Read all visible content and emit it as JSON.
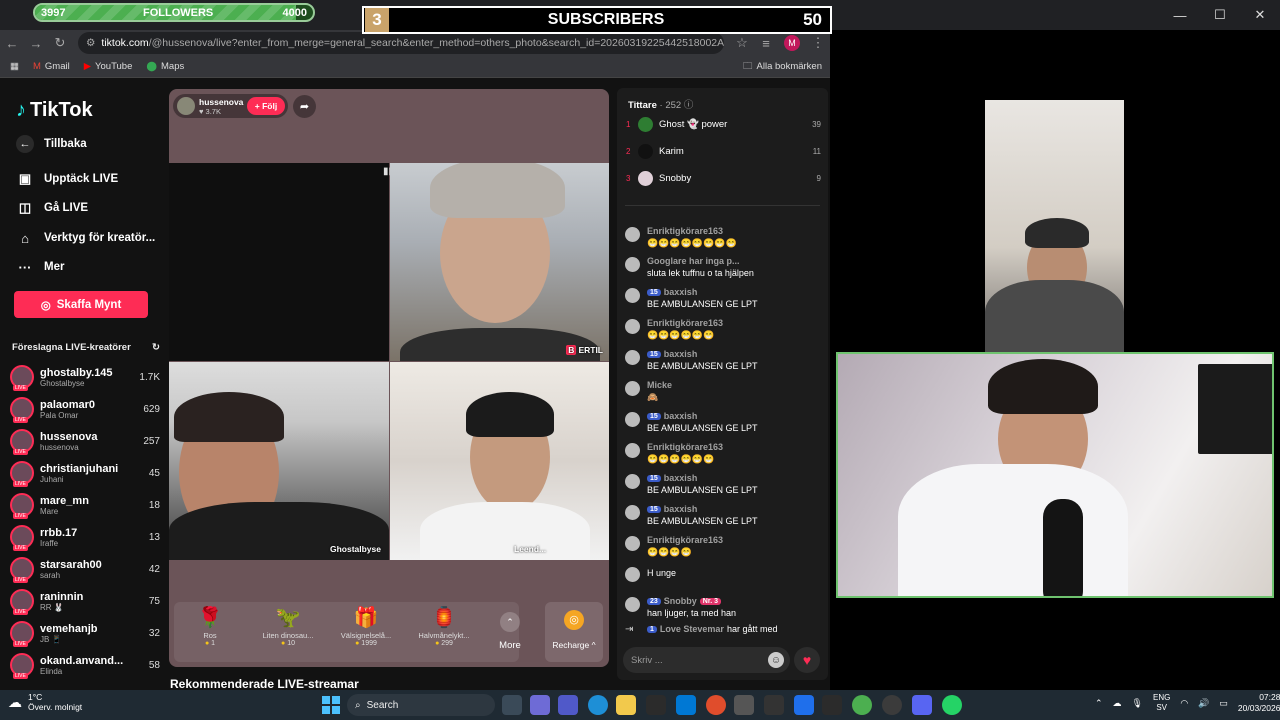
{
  "overlay": {
    "followers": {
      "start": "3997",
      "label": "FOLLOWERS",
      "goal": "4000",
      "progress": 0.94
    },
    "subscribers": {
      "number": "3",
      "label": "SUBSCRIBERS",
      "count": "50"
    }
  },
  "browser": {
    "url_host": "tiktok.com",
    "url_rest": "/@hussenova/live?enter_from_merge=general_search&enter_method=others_photo&search_id=20260319225442518002AFC643CC8EC0E...",
    "profile_initial": "M",
    "bookmarks": [
      {
        "label": "Gmail",
        "icon": "gmail-icon"
      },
      {
        "label": "YouTube",
        "icon": "youtube-icon"
      },
      {
        "label": "Maps",
        "icon": "maps-icon"
      }
    ],
    "all_bookmarks": "Alla bokmärken"
  },
  "sidebar": {
    "logo": "TikTok",
    "back": "Tillbaka",
    "nav": [
      {
        "label": "Upptäck LIVE",
        "icon": "calendar-icon"
      },
      {
        "label": "Gå LIVE",
        "icon": "video-camera-icon"
      },
      {
        "label": "Verktyg för kreatör...",
        "icon": "tools-icon"
      },
      {
        "label": "Mer",
        "icon": "more-dots-icon"
      }
    ],
    "coins_button": "Skaffa Mynt",
    "suggested_title": "Föreslagna LIVE-kreatörer",
    "creators": [
      {
        "name": "ghostalby.145",
        "sub": "Ghostalbyse",
        "viewers": "1.7K"
      },
      {
        "name": "palaomar0",
        "sub": "Pala Omar",
        "viewers": "629"
      },
      {
        "name": "hussenova",
        "sub": "hussenova",
        "viewers": "257"
      },
      {
        "name": "christianjuhani",
        "sub": "Juhani",
        "viewers": "45"
      },
      {
        "name": "mare_mn",
        "sub": "Mare",
        "viewers": "18"
      },
      {
        "name": "rrbb.17",
        "sub": "Iraffe",
        "viewers": "13"
      },
      {
        "name": "starsarah00",
        "sub": "sarah",
        "viewers": "42"
      },
      {
        "name": "raninnin",
        "sub": "RR 🐰",
        "viewers": "75"
      },
      {
        "name": "vemehanjb",
        "sub": "JB 📱",
        "viewers": "32"
      },
      {
        "name": "okand.anvand...",
        "sub": "Elinda",
        "viewers": "58"
      }
    ]
  },
  "live": {
    "host_name": "hussenova",
    "host_likes": "♥ 3.7K",
    "follow": "+ Följ",
    "tiles": {
      "tr_label": "ERTIL",
      "bl_label": "Ghostalbyse",
      "br_label": "Leend..."
    },
    "gifts": [
      {
        "name": "Ros",
        "price": "1",
        "icon": "🌹"
      },
      {
        "name": "Liten dinosau...",
        "price": "10",
        "icon": "🦖"
      },
      {
        "name": "Välsignelselå...",
        "price": "1999",
        "icon": "🎁"
      },
      {
        "name": "Halvmånelykt...",
        "price": "299",
        "icon": "🏮"
      }
    ],
    "more": "More",
    "recharge": "Recharge ^",
    "recommended": "Rekommenderade LIVE-streamar"
  },
  "chat": {
    "viewers_label": "Tittare",
    "viewers_count": "· 252",
    "top": [
      {
        "rank": "1",
        "name": "Ghost 👻 power",
        "score": "39",
        "color": "#2e7d32"
      },
      {
        "rank": "2",
        "name": "Karim",
        "score": "11",
        "color": "#111111"
      },
      {
        "rank": "3",
        "name": "Snobby",
        "score": "9",
        "color": "#e0d0d8"
      }
    ],
    "messages": [
      {
        "user": "Enriktigkörare163",
        "badge": "",
        "text": "😁😁😁😁😁😁😁😁"
      },
      {
        "user": "Googlare har inga p...",
        "badge": "",
        "text": "sluta lek tuffnu o ta hjälpen"
      },
      {
        "user": "baxxish",
        "badge": "15",
        "text": "BE AMBULANSEN GE LPT"
      },
      {
        "user": "Enriktigkörare163",
        "badge": "",
        "text": "😁😁😁😁😁😁"
      },
      {
        "user": "baxxish",
        "badge": "15",
        "text": "BE AMBULANSEN GE LPT"
      },
      {
        "user": "Micke",
        "badge": "",
        "text": "🙈"
      },
      {
        "user": "baxxish",
        "badge": "15",
        "text": "BE AMBULANSEN GE LPT"
      },
      {
        "user": "Enriktigkörare163",
        "badge": "",
        "text": "😁😁😁😁😁😁"
      },
      {
        "user": "baxxish",
        "badge": "15",
        "text": "BE AMBULANSEN GE LPT"
      },
      {
        "user": "baxxish",
        "badge": "15",
        "text": "BE AMBULANSEN GE LPT"
      },
      {
        "user": "Enriktigkörare163",
        "badge": "",
        "text": "😁😁😁😁"
      },
      {
        "user": "",
        "badge": "",
        "text": "H unge"
      },
      {
        "user": "Snobby",
        "badge": "23",
        "badge2": "Nr. 3",
        "text": "han ljuger, ta med han"
      }
    ],
    "join_notice": {
      "badge": "1",
      "user": "Love Stevemar",
      "text": "har gått med"
    },
    "input_placeholder": "Skriv ..."
  },
  "taskbar": {
    "temp": "1°C",
    "weather": "Överv. molnigt",
    "search": "Search",
    "lang": "ENG",
    "region": "SV",
    "time": "07:28",
    "date": "20/03/2026"
  }
}
